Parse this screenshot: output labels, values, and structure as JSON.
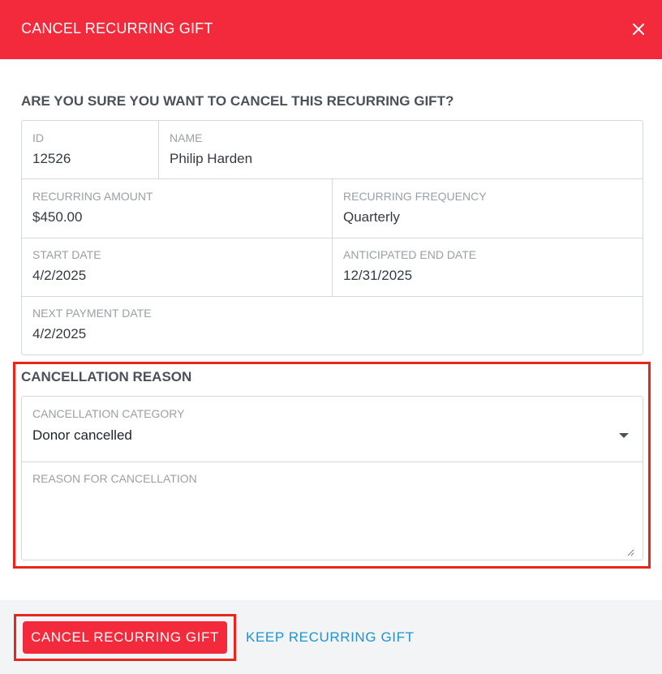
{
  "dialog": {
    "title": "CANCEL RECURRING GIFT",
    "close_icon": "close-icon",
    "question": "ARE YOU SURE YOU WANT TO CANCEL THIS RECURRING GIFT?"
  },
  "gift": {
    "id": {
      "label": "ID",
      "value": "12526"
    },
    "name": {
      "label": "NAME",
      "value": "Philip Harden"
    },
    "recurring_amount": {
      "label": "RECURRING AMOUNT",
      "value": "$450.00"
    },
    "recurring_frequency": {
      "label": "RECURRING FREQUENCY",
      "value": "Quarterly"
    },
    "start_date": {
      "label": "START DATE",
      "value": "4/2/2025"
    },
    "anticipated_end_date": {
      "label": "ANTICIPATED END DATE",
      "value": "12/31/2025"
    },
    "next_payment_date": {
      "label": "NEXT PAYMENT DATE",
      "value": "4/2/2025"
    }
  },
  "cancellation": {
    "title": "CANCELLATION REASON",
    "category_label": "CANCELLATION CATEGORY",
    "category_value": "Donor cancelled",
    "reason_label": "REASON FOR CANCELLATION",
    "reason_value": ""
  },
  "footer": {
    "cancel_button": "CANCEL RECURRING GIFT",
    "keep_button": "KEEP RECURRING GIFT"
  },
  "colors": {
    "header": "#f22a3b",
    "highlight": "#e8261a",
    "link": "#1b95d1"
  }
}
